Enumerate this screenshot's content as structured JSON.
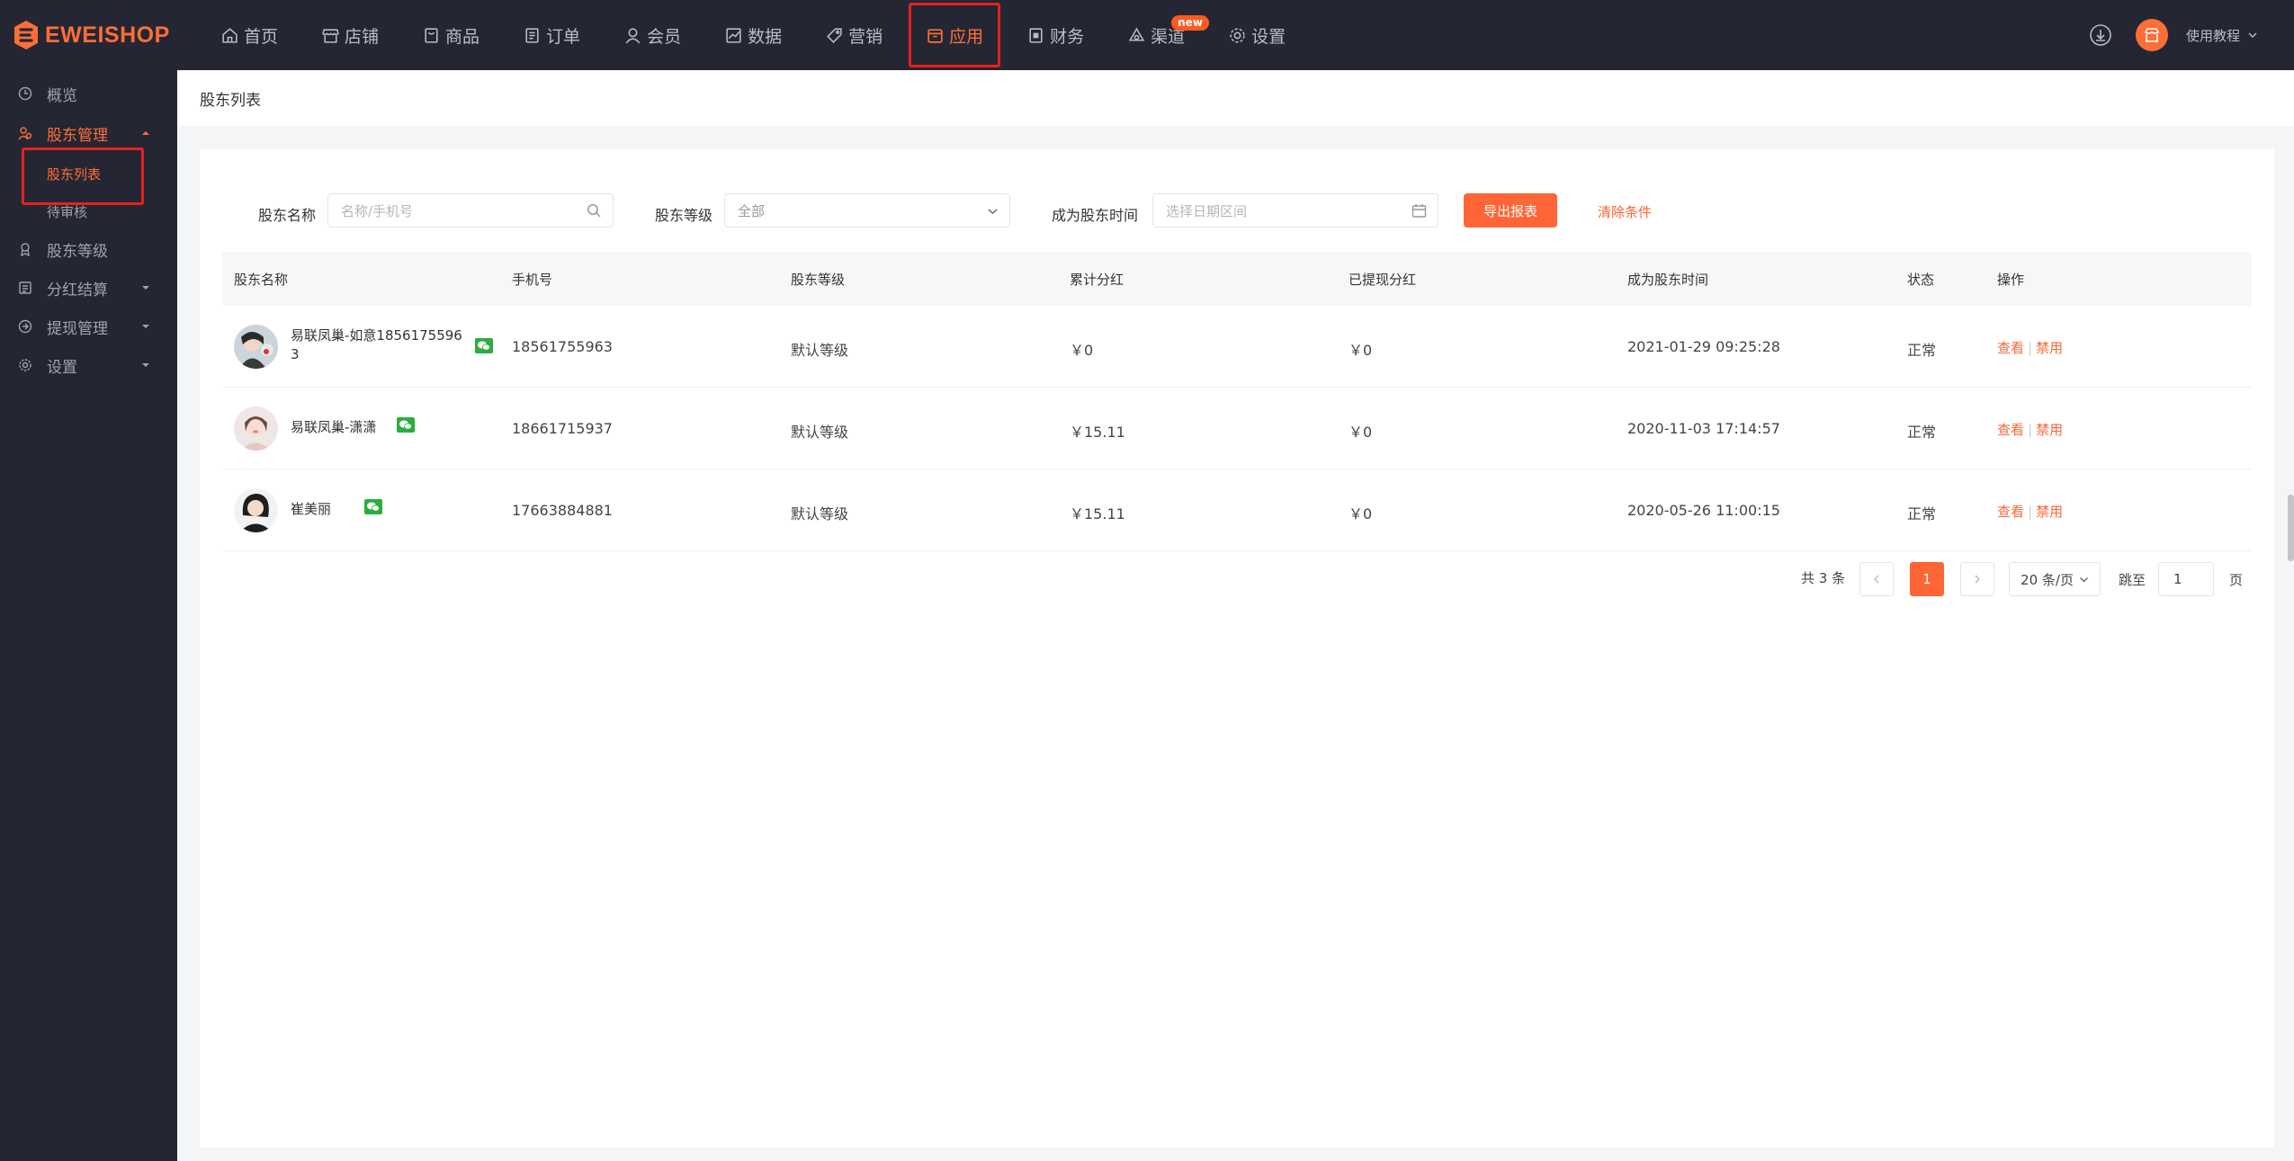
{
  "brand": {
    "name": "EWEISHOP",
    "accent": "#ff6e36"
  },
  "topnav": {
    "items": [
      {
        "label": "首页",
        "icon": "home-icon"
      },
      {
        "label": "店铺",
        "icon": "store-icon"
      },
      {
        "label": "商品",
        "icon": "goods-icon"
      },
      {
        "label": "订单",
        "icon": "order-icon"
      },
      {
        "label": "会员",
        "icon": "member-icon"
      },
      {
        "label": "数据",
        "icon": "chart-icon"
      },
      {
        "label": "营销",
        "icon": "tag-icon"
      },
      {
        "label": "应用",
        "icon": "app-icon",
        "active": true
      },
      {
        "label": "财务",
        "icon": "finance-icon"
      },
      {
        "label": "渠道",
        "icon": "channel-icon",
        "badge": "new"
      },
      {
        "label": "设置",
        "icon": "settings-icon"
      }
    ],
    "tutorial_label": "使用教程"
  },
  "sidebar": {
    "items": [
      {
        "label": "概览",
        "icon": "clock-icon"
      },
      {
        "label": "股东管理",
        "icon": "shareholder-icon",
        "open": true
      },
      {
        "label": "股东等级",
        "icon": "level-icon"
      },
      {
        "label": "分红结算",
        "icon": "settlement-icon"
      },
      {
        "label": "提现管理",
        "icon": "withdraw-icon"
      },
      {
        "label": "设置",
        "icon": "gear-icon"
      }
    ],
    "sub": [
      {
        "label": "股东列表",
        "active": true
      },
      {
        "label": "待审核"
      }
    ]
  },
  "page": {
    "title": "股东列表"
  },
  "filters": {
    "name_label": "股东名称",
    "name_placeholder": "名称/手机号",
    "level_label": "股东等级",
    "level_value": "全部",
    "time_label": "成为股东时间",
    "time_placeholder": "选择日期区间",
    "export_label": "导出报表",
    "clear_label": "清除条件"
  },
  "table": {
    "headers": [
      "股东名称",
      "手机号",
      "股东等级",
      "累计分红",
      "已提现分红",
      "成为股东时间",
      "状态",
      "操作"
    ],
    "rows": [
      {
        "name": "易联凤巢-如意18561755963",
        "phone": "18561755963",
        "level": "默认等级",
        "total": "￥0",
        "withdrawn": "￥0",
        "time": "2021-01-29 09:25:28",
        "status": "正常",
        "view": "查看",
        "disable": "禁用"
      },
      {
        "name": "易联凤巢-潇潇",
        "phone": "18661715937",
        "level": "默认等级",
        "total": "￥15.11",
        "withdrawn": "￥0",
        "time": "2020-11-03 17:14:57",
        "status": "正常",
        "view": "查看",
        "disable": "禁用"
      },
      {
        "name": "崔美丽",
        "phone": "17663884881",
        "level": "默认等级",
        "total": "￥15.11",
        "withdrawn": "￥0",
        "time": "2020-05-26 11:00:15",
        "status": "正常",
        "view": "查看",
        "disable": "禁用"
      }
    ]
  },
  "pagination": {
    "total_text": "共 3 条",
    "current": "1",
    "page_size": "20 条/页",
    "goto_label": "跳至",
    "goto_value": "1",
    "page_unit": "页"
  }
}
